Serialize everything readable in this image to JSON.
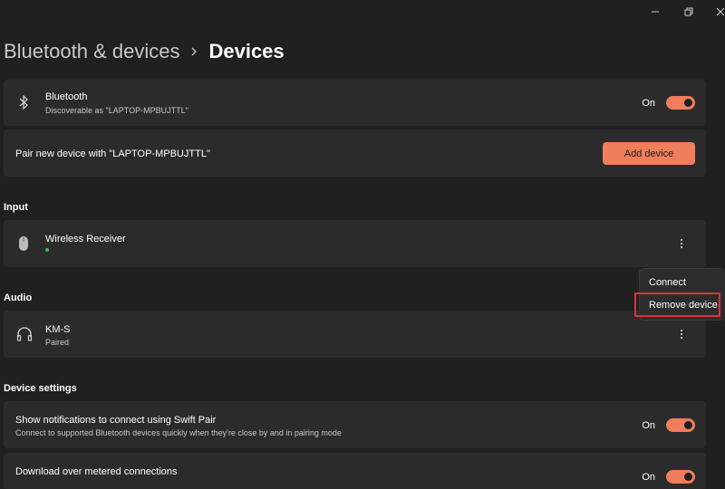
{
  "window": {
    "minimize_icon": "minimize-icon",
    "restore_icon": "restore-icon",
    "close_icon": "close-icon"
  },
  "breadcrumb": {
    "parent": "Bluetooth & devices",
    "separator_icon": "chevron-right-icon",
    "current": "Devices"
  },
  "bluetooth": {
    "icon": "bluetooth-icon",
    "title": "Bluetooth",
    "subtitle": "Discoverable as \"LAPTOP-MPBUJTTL\"",
    "toggle_label": "On",
    "enabled": true
  },
  "pair": {
    "title": "Pair new device with \"LAPTOP-MPBUJTTL\"",
    "button_label": "Add device"
  },
  "sections": {
    "input": "Input",
    "audio": "Audio",
    "device_settings": "Device settings"
  },
  "input_devices": [
    {
      "icon": "mouse-icon",
      "name": "Wireless Receiver",
      "status_dot_color": "#3fb950"
    }
  ],
  "audio_devices": [
    {
      "icon": "headphones-icon",
      "name": "KM-S",
      "status": "Paired"
    }
  ],
  "context_menu": {
    "items": [
      "Connect",
      "Remove device"
    ],
    "highlighted_item": "Remove device",
    "highlight_color": "#e0303a"
  },
  "settings": [
    {
      "title": "Show notifications to connect using Swift Pair",
      "subtitle": "Connect to supported Bluetooth devices quickly when they're close by and in pairing mode",
      "toggle_label": "On",
      "enabled": true
    },
    {
      "title": "Download over metered connections",
      "toggle_label": "On",
      "enabled": true
    }
  ],
  "colors": {
    "accent": "#f07d5c",
    "background": "#202020",
    "card": "#2b2b2b"
  }
}
